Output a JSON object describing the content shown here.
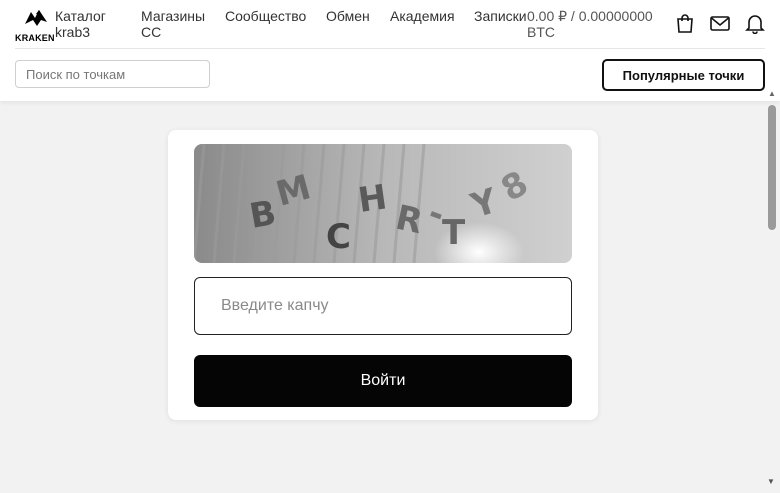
{
  "header": {
    "logo_text": "KRAKEN",
    "catalog": "Каталог krab3",
    "nav": [
      {
        "label": "Магазины СС"
      },
      {
        "label": "Сообщество"
      },
      {
        "label": "Обмен"
      },
      {
        "label": "Академия"
      },
      {
        "label": "Записки"
      }
    ],
    "balance": "0.00 ₽ / 0.00000000 BTC",
    "icons": [
      "shopping-bag-icon",
      "mail-icon",
      "bell-icon"
    ]
  },
  "search": {
    "placeholder": "Поиск по точкам"
  },
  "popular_button": "Популярные точки",
  "captcha": {
    "image_text": "BMCHR-TY8",
    "input_placeholder": "Введите капчу"
  },
  "login_button": "Войти",
  "colors": {
    "accent": "#050505",
    "background": "#f2f2f2",
    "card": "#ffffff"
  }
}
